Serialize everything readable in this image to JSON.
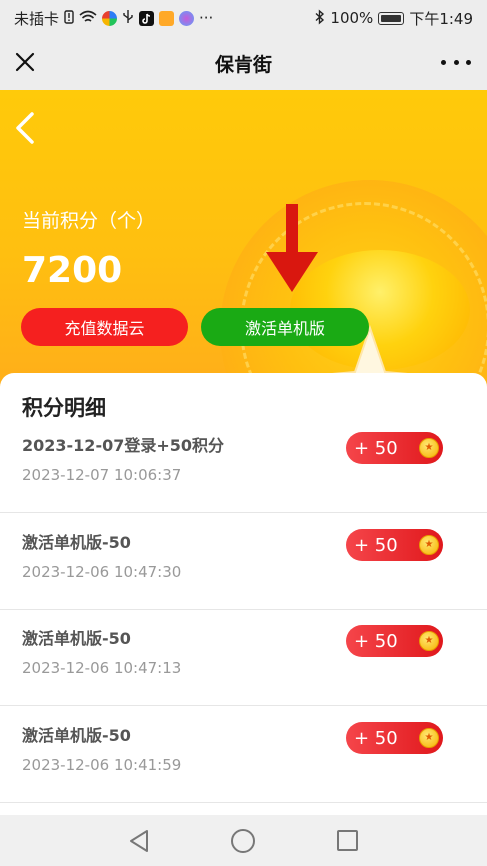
{
  "status_bar": {
    "carrier": "未插卡",
    "battery": "100%",
    "time": "下午1:49",
    "icons": [
      "alert-icon",
      "wifi-icon",
      "app-icon",
      "usb-icon",
      "tiktok-icon",
      "app-icon",
      "app-icon",
      "more-icon",
      "bluetooth-icon",
      "battery-icon"
    ],
    "more_glyph": "···"
  },
  "title_bar": {
    "title": "保肯街"
  },
  "hero": {
    "points_label": "当前积分（个）",
    "points_value": "7200",
    "recharge_button": "充值数据云",
    "activate_button": "激活单机版",
    "colors": {
      "background": "#ffc00d",
      "recharge": "#f5201f",
      "activate": "#1aaa14",
      "arrow": "#d9170f"
    }
  },
  "points_detail": {
    "heading": "积分明细",
    "records": [
      {
        "title": "2023-12-07登录+50积分",
        "time": "2023-12-07 10:06:37",
        "amount": "+ 50"
      },
      {
        "title": "激活单机版-50",
        "time": "2023-12-06 10:47:30",
        "amount": "+ 50"
      },
      {
        "title": "激活单机版-50",
        "time": "2023-12-06 10:47:13",
        "amount": "+ 50"
      },
      {
        "title": "激活单机版-50",
        "time": "2023-12-06 10:41:59",
        "amount": "+ 50"
      }
    ]
  }
}
